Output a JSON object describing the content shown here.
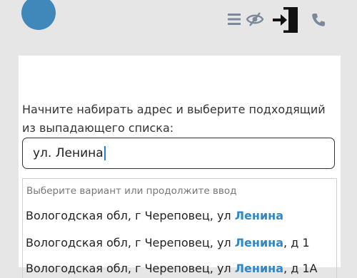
{
  "header": {
    "icons": [
      "menu-icon",
      "eye-slash-icon",
      "exit-icon",
      "phone-icon"
    ]
  },
  "prompt": "Начните набирать адрес и выберите подходящий из выпадающего списка:",
  "address_input": {
    "value": "ул. Ленина"
  },
  "dropdown": {
    "hint": "Выберите вариант или продолжите ввод",
    "options": [
      {
        "prefix": "Вологодская обл, г Череповец, ул ",
        "match": "Ленина",
        "suffix": ""
      },
      {
        "prefix": "Вологодская обл, г Череповец, ул ",
        "match": "Ленина",
        "suffix": ", д 1"
      },
      {
        "prefix": "Вологодская обл, г Череповец, ул ",
        "match": "Ленина",
        "suffix": ", д 1А"
      }
    ]
  },
  "colors": {
    "accent": "#2f86c8",
    "avatar": "#3f88b9",
    "icon": "#7a8a99",
    "caret": "#1f7fd6"
  }
}
